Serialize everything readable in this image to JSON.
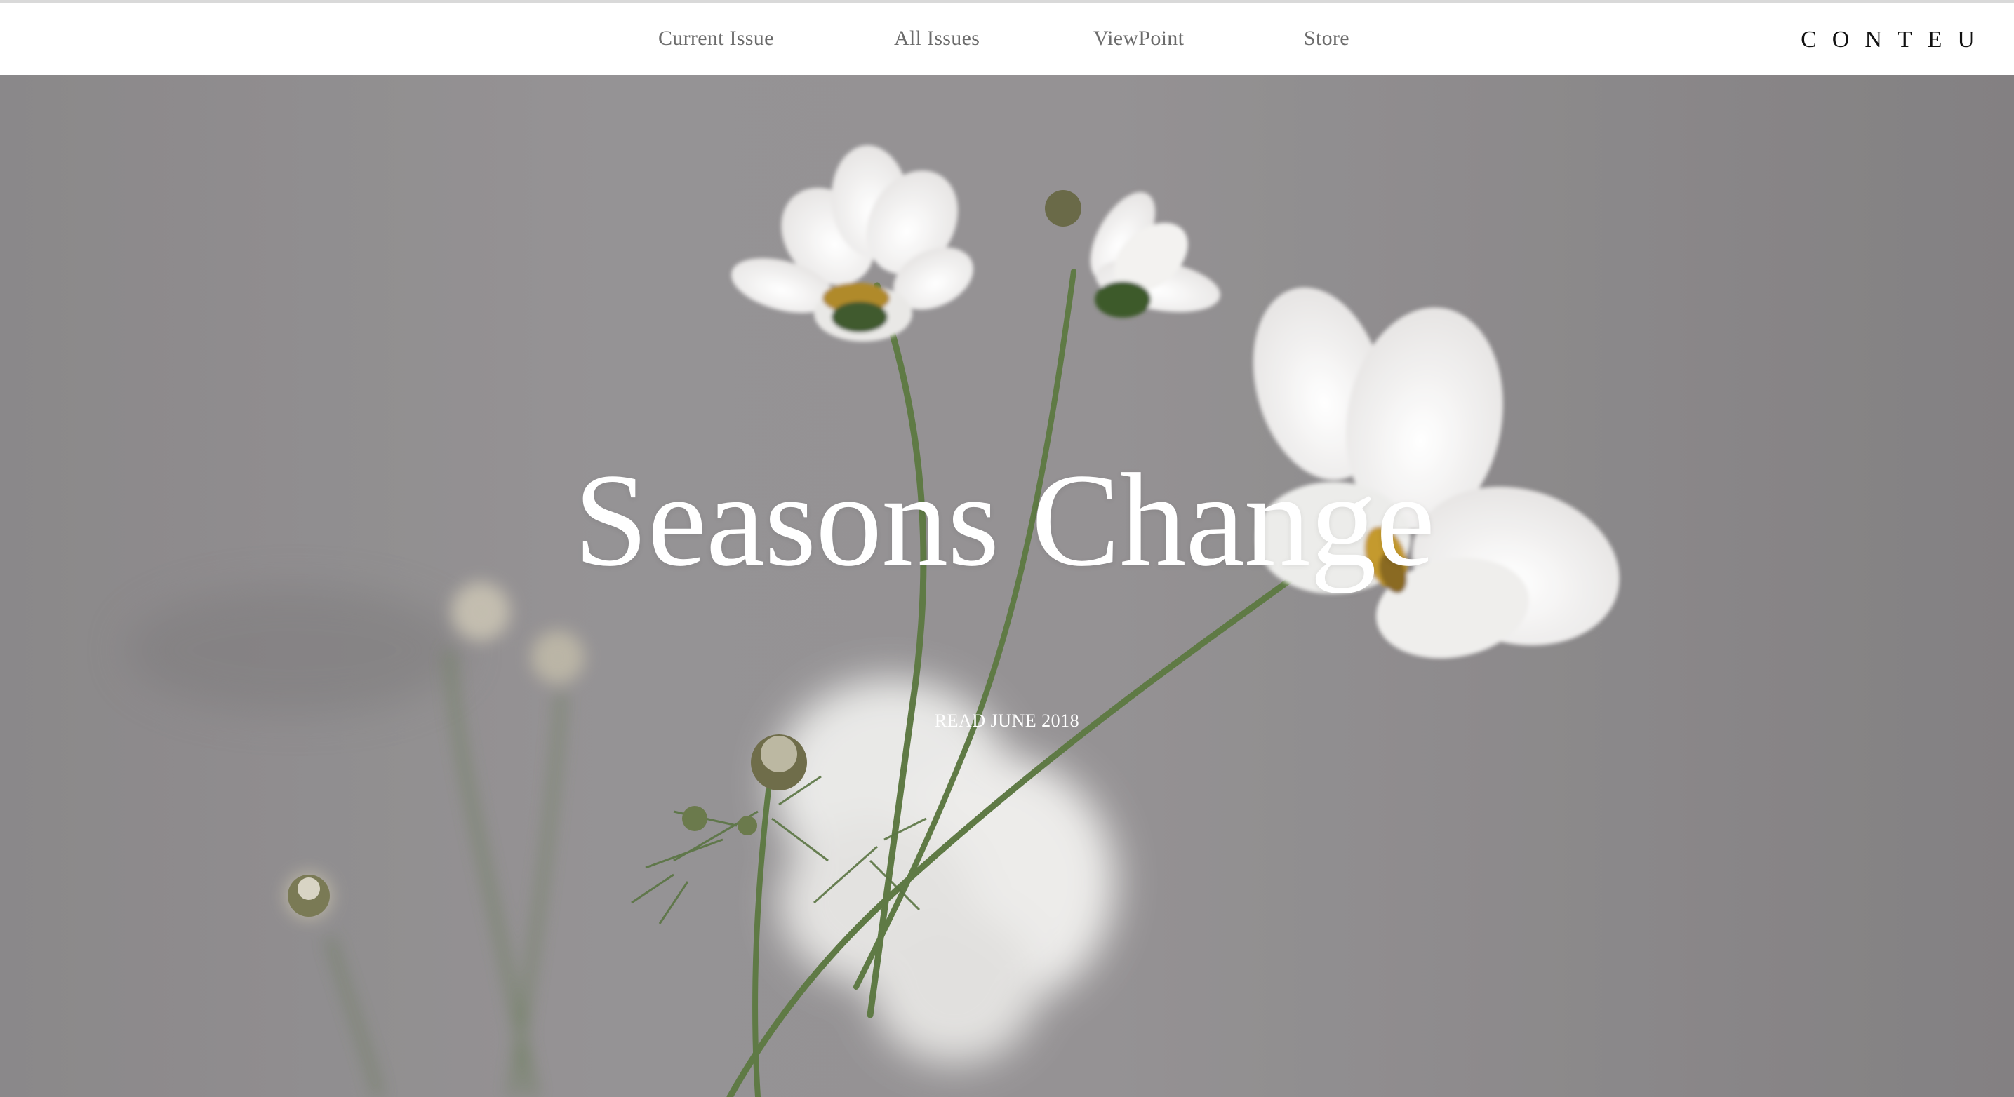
{
  "nav": {
    "items": [
      {
        "label": "Current Issue"
      },
      {
        "label": "All Issues"
      },
      {
        "label": "ViewPoint"
      },
      {
        "label": "Store"
      }
    ],
    "brand": "CONTEU"
  },
  "hero": {
    "title": "Seasons Change",
    "cta": "READ JUNE 2018",
    "image": "white-cosmos-flowers-photo"
  },
  "colors": {
    "nav_background": "#ffffff",
    "nav_text": "#6b6b6b",
    "brand_text": "#111111",
    "hero_background": "#8f8c8e",
    "hero_text": "#ffffff"
  }
}
